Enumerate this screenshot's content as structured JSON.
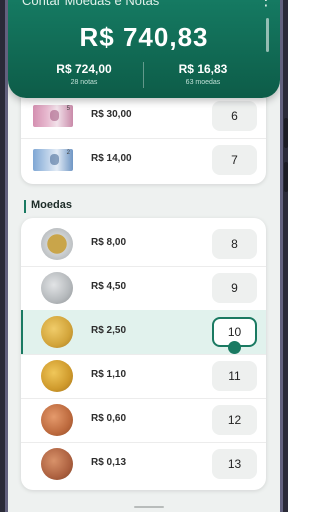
{
  "header": {
    "title": "Contar Moedas e Notas",
    "menu_icon": "⋮",
    "total": "R$ 740,83",
    "notes_total": "R$ 724,00",
    "notes_count": "28 notas",
    "coins_total": "R$ 16,83",
    "coins_count": "63 moedas"
  },
  "notes": [
    {
      "icon": "banknote-5-icon",
      "denom": "5",
      "color": "#d48fb0",
      "value": "R$ 30,00",
      "qty": "6"
    },
    {
      "icon": "banknote-2-icon",
      "denom": "2",
      "color": "#7fa7d4",
      "value": "R$ 14,00",
      "qty": "7"
    }
  ],
  "coins_section": {
    "title": "Moedas"
  },
  "coins": [
    {
      "icon": "coin-1-real-icon",
      "value": "R$ 8,00",
      "qty": "8"
    },
    {
      "icon": "coin-50-centavos-icon",
      "value": "R$ 4,50",
      "qty": "9"
    },
    {
      "icon": "coin-25-centavos-icon",
      "value": "R$ 2,50",
      "qty": "10",
      "active": true
    },
    {
      "icon": "coin-10-centavos-icon",
      "value": "R$ 1,10",
      "qty": "11"
    },
    {
      "icon": "coin-5-centavos-icon",
      "value": "R$ 0,60",
      "qty": "12"
    },
    {
      "icon": "coin-1-centavo-icon",
      "value": "R$ 0,13",
      "qty": "13"
    }
  ]
}
